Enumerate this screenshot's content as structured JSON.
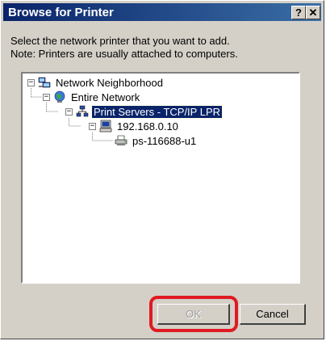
{
  "window": {
    "title": "Browse for Printer",
    "help_button": "?",
    "close_button": "✕"
  },
  "instructions": {
    "line1": "Select the network printer that you want to add.",
    "line2": "Note: Printers are usually attached to computers."
  },
  "tree": {
    "nodes": [
      {
        "label": "Network Neighborhood",
        "icon": "network-neighborhood-icon",
        "expander": "−"
      },
      {
        "label": "Entire Network",
        "icon": "globe-icon",
        "expander": "−"
      },
      {
        "label": "Print Servers - TCP/IP LPR",
        "icon": "network-group-icon",
        "expander": "−",
        "selected": true
      },
      {
        "label": "192.168.0.10",
        "icon": "computer-icon",
        "expander": "−"
      },
      {
        "label": "ps-116688-u1",
        "icon": "printer-icon"
      }
    ]
  },
  "buttons": {
    "ok": "OK",
    "cancel": "Cancel"
  },
  "colors": {
    "titlebar": "#0a246a",
    "dialog_face": "#d4d0c8",
    "selection": "#0a246a",
    "highlight_ring": "#e01a22"
  }
}
